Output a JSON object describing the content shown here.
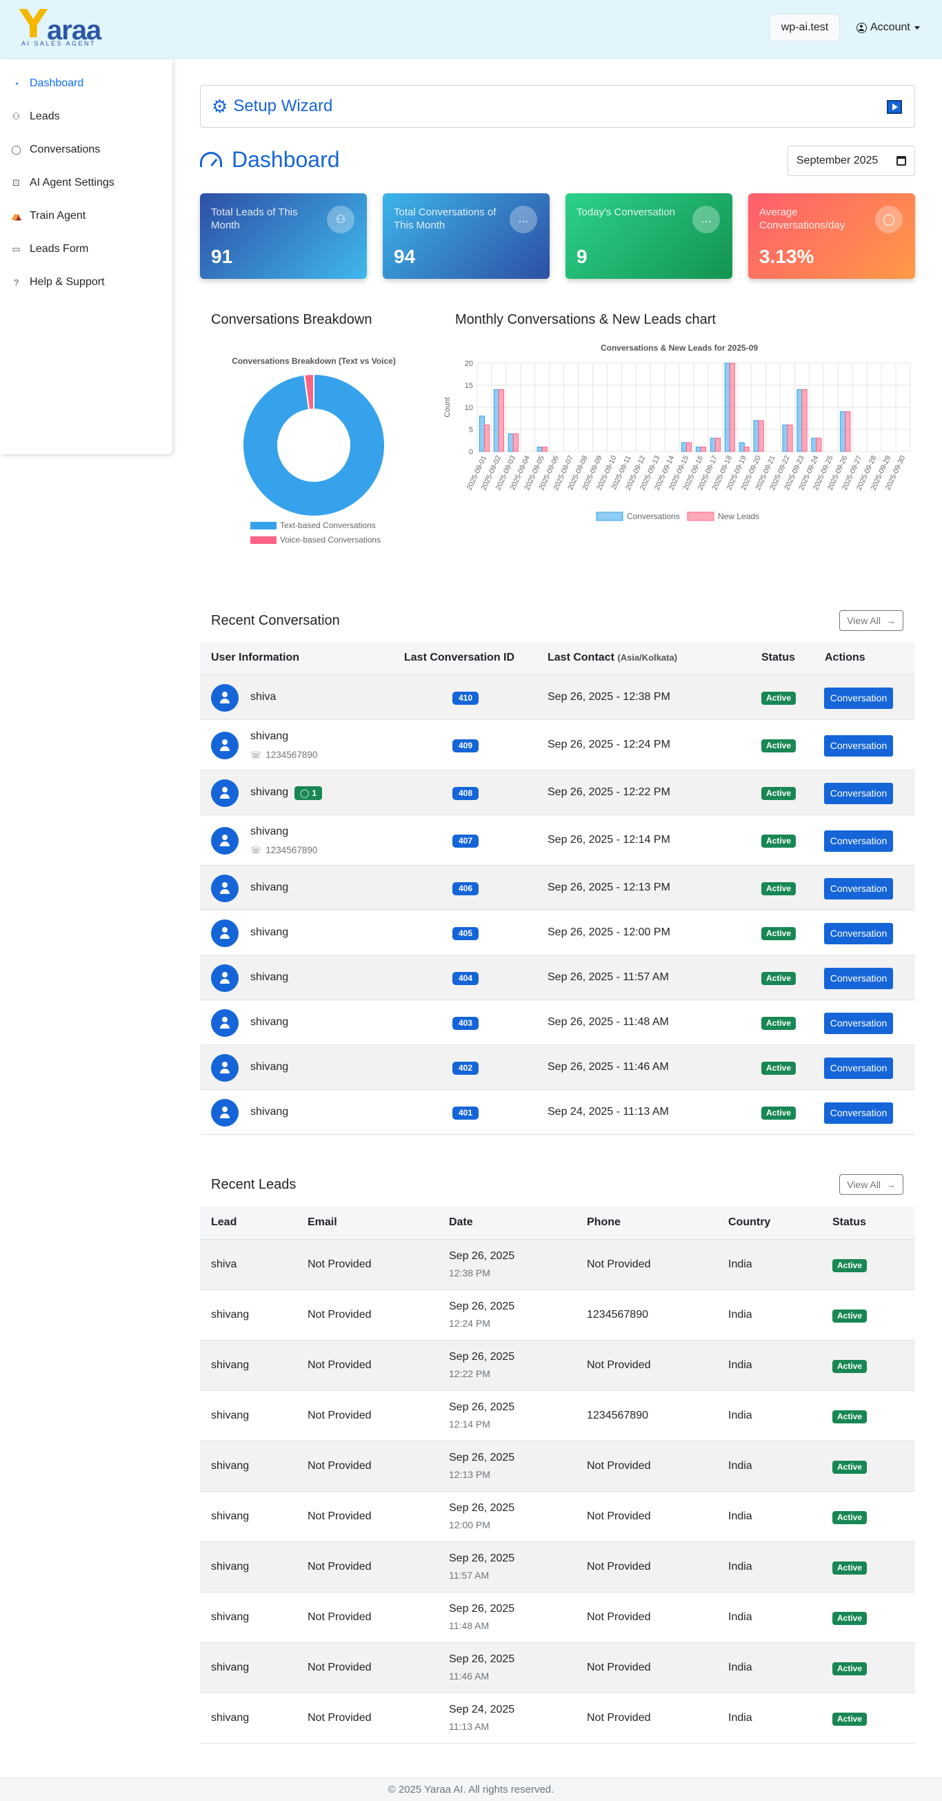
{
  "brand": {
    "logo_initial": "Y",
    "logo_rest": "araa",
    "tagline": "AI SALES AGENT"
  },
  "header": {
    "site_button": "wp-ai.test",
    "account_label": "Account"
  },
  "sidebar": {
    "items": [
      {
        "label": "Dashboard",
        "icon": "gauge-icon",
        "glyph": "◔"
      },
      {
        "label": "Leads",
        "icon": "people-icon",
        "glyph": "⚇"
      },
      {
        "label": "Conversations",
        "icon": "chat-icon",
        "glyph": "◯"
      },
      {
        "label": "AI Agent Settings",
        "icon": "robot-icon",
        "glyph": "⊡"
      },
      {
        "label": "Train Agent",
        "icon": "train-icon",
        "glyph": "⛺"
      },
      {
        "label": "Leads Form",
        "icon": "form-icon",
        "glyph": "▭"
      },
      {
        "label": "Help & Support",
        "icon": "help-icon",
        "glyph": "?"
      }
    ]
  },
  "setup": {
    "title": "Setup Wizard",
    "gear_glyph": "⚙"
  },
  "dashboard": {
    "title": "Dashboard",
    "month": "September 2025"
  },
  "cards": [
    {
      "label": "Total Leads of This Month",
      "value": "91",
      "glyph": "⚇"
    },
    {
      "label": "Total Conversations of This Month",
      "value": "94",
      "glyph": "…"
    },
    {
      "label": "Today's Conversation",
      "value": "9",
      "glyph": "…"
    },
    {
      "label": "Average Conversations/day",
      "value": "3.13%",
      "glyph": "◯"
    }
  ],
  "breakdown": {
    "title": "Conversations Breakdown"
  },
  "monthly": {
    "title": "Monthly Conversations & New Leads chart"
  },
  "colors": {
    "blue": "#36a2eb",
    "pink": "#ff6384",
    "accent": "#1565d8",
    "success": "#198754"
  },
  "chart_data": [
    {
      "type": "pie",
      "title": "Conversations Breakdown (Text vs Voice)",
      "labels": [
        "Text-based Conversations",
        "Voice-based Conversations"
      ],
      "values": [
        92,
        2
      ],
      "legend": "bottom"
    },
    {
      "type": "bar",
      "title": "Conversations & New Leads for 2025-09",
      "ylabel": "Count",
      "ylim": [
        0,
        20
      ],
      "yticks": [
        "0",
        "5",
        "10",
        "15",
        "20"
      ],
      "grid": true,
      "legend": "bottom",
      "categories": [
        "2025-09-01",
        "2025-09-02",
        "2025-09-03",
        "2025-09-04",
        "2025-09-05",
        "2025-09-06",
        "2025-09-07",
        "2025-09-08",
        "2025-09-09",
        "2025-09-10",
        "2025-09-11",
        "2025-09-12",
        "2025-09-13",
        "2025-09-14",
        "2025-09-15",
        "2025-09-16",
        "2025-09-17",
        "2025-09-18",
        "2025-09-19",
        "2025-09-20",
        "2025-09-21",
        "2025-09-22",
        "2025-09-23",
        "2025-09-24",
        "2025-09-25",
        "2025-09-26",
        "2025-09-27",
        "2025-09-28",
        "2025-09-29",
        "2025-09-30"
      ],
      "series": [
        {
          "name": "Conversations",
          "values": [
            8,
            14,
            4,
            0,
            1,
            0,
            0,
            0,
            0,
            0,
            0,
            0,
            0,
            0,
            2,
            1,
            3,
            20,
            2,
            7,
            0,
            6,
            14,
            3,
            0,
            9,
            0,
            0,
            0,
            0
          ]
        },
        {
          "name": "New Leads",
          "values": [
            6,
            14,
            4,
            0,
            1,
            0,
            0,
            0,
            0,
            0,
            0,
            0,
            0,
            0,
            2,
            1,
            3,
            20,
            1,
            7,
            0,
            6,
            14,
            3,
            0,
            9,
            0,
            0,
            0,
            0
          ]
        }
      ]
    }
  ],
  "recent_conversation": {
    "title": "Recent Conversation",
    "view_all": "View All",
    "headers": {
      "user": "User Information",
      "id": "Last Conversation ID",
      "contact": "Last Contact",
      "tz": "(Asia/Kolkata)",
      "status": "Status",
      "actions": "Actions"
    },
    "rows": [
      {
        "name": "shiva",
        "phone": "",
        "msgs": "",
        "id": "410",
        "contact": "Sep 26, 2025 - 12:38 PM",
        "status": "Active",
        "action": "Conversation"
      },
      {
        "name": "shivang",
        "phone": "1234567890",
        "msgs": "",
        "id": "409",
        "contact": "Sep 26, 2025 - 12:24 PM",
        "status": "Active",
        "action": "Conversation"
      },
      {
        "name": "shivang",
        "phone": "",
        "msgs": "1",
        "id": "408",
        "contact": "Sep 26, 2025 - 12:22 PM",
        "status": "Active",
        "action": "Conversation"
      },
      {
        "name": "shivang",
        "phone": "1234567890",
        "msgs": "",
        "id": "407",
        "contact": "Sep 26, 2025 - 12:14 PM",
        "status": "Active",
        "action": "Conversation"
      },
      {
        "name": "shivang",
        "phone": "",
        "msgs": "",
        "id": "406",
        "contact": "Sep 26, 2025 - 12:13 PM",
        "status": "Active",
        "action": "Conversation"
      },
      {
        "name": "shivang",
        "phone": "",
        "msgs": "",
        "id": "405",
        "contact": "Sep 26, 2025 - 12:00 PM",
        "status": "Active",
        "action": "Conversation"
      },
      {
        "name": "shivang",
        "phone": "",
        "msgs": "",
        "id": "404",
        "contact": "Sep 26, 2025 - 11:57 AM",
        "status": "Active",
        "action": "Conversation"
      },
      {
        "name": "shivang",
        "phone": "",
        "msgs": "",
        "id": "403",
        "contact": "Sep 26, 2025 - 11:48 AM",
        "status": "Active",
        "action": "Conversation"
      },
      {
        "name": "shivang",
        "phone": "",
        "msgs": "",
        "id": "402",
        "contact": "Sep 26, 2025 - 11:46 AM",
        "status": "Active",
        "action": "Conversation"
      },
      {
        "name": "shivang",
        "phone": "",
        "msgs": "",
        "id": "401",
        "contact": "Sep 24, 2025 - 11:13 AM",
        "status": "Active",
        "action": "Conversation"
      }
    ]
  },
  "recent_leads": {
    "title": "Recent Leads",
    "view_all": "View All",
    "headers": {
      "lead": "Lead",
      "email": "Email",
      "date": "Date",
      "phone": "Phone",
      "country": "Country",
      "status": "Status"
    },
    "rows": [
      {
        "lead": "shiva",
        "email": "Not Provided",
        "date": "Sep 26, 2025",
        "time": "12:38 PM",
        "phone": "Not Provided",
        "country": "India",
        "status": "Active"
      },
      {
        "lead": "shivang",
        "email": "Not Provided",
        "date": "Sep 26, 2025",
        "time": "12:24 PM",
        "phone": "1234567890",
        "country": "India",
        "status": "Active"
      },
      {
        "lead": "shivang",
        "email": "Not Provided",
        "date": "Sep 26, 2025",
        "time": "12:22 PM",
        "phone": "Not Provided",
        "country": "India",
        "status": "Active"
      },
      {
        "lead": "shivang",
        "email": "Not Provided",
        "date": "Sep 26, 2025",
        "time": "12:14 PM",
        "phone": "1234567890",
        "country": "India",
        "status": "Active"
      },
      {
        "lead": "shivang",
        "email": "Not Provided",
        "date": "Sep 26, 2025",
        "time": "12:13 PM",
        "phone": "Not Provided",
        "country": "India",
        "status": "Active"
      },
      {
        "lead": "shivang",
        "email": "Not Provided",
        "date": "Sep 26, 2025",
        "time": "12:00 PM",
        "phone": "Not Provided",
        "country": "India",
        "status": "Active"
      },
      {
        "lead": "shivang",
        "email": "Not Provided",
        "date": "Sep 26, 2025",
        "time": "11:57 AM",
        "phone": "Not Provided",
        "country": "India",
        "status": "Active"
      },
      {
        "lead": "shivang",
        "email": "Not Provided",
        "date": "Sep 26, 2025",
        "time": "11:48 AM",
        "phone": "Not Provided",
        "country": "India",
        "status": "Active"
      },
      {
        "lead": "shivang",
        "email": "Not Provided",
        "date": "Sep 26, 2025",
        "time": "11:46 AM",
        "phone": "Not Provided",
        "country": "India",
        "status": "Active"
      },
      {
        "lead": "shivang",
        "email": "Not Provided",
        "date": "Sep 24, 2025",
        "time": "11:13 AM",
        "phone": "Not Provided",
        "country": "India",
        "status": "Active"
      }
    ]
  },
  "footer": {
    "text": "© 2025 Yaraa AI. All rights reserved."
  }
}
